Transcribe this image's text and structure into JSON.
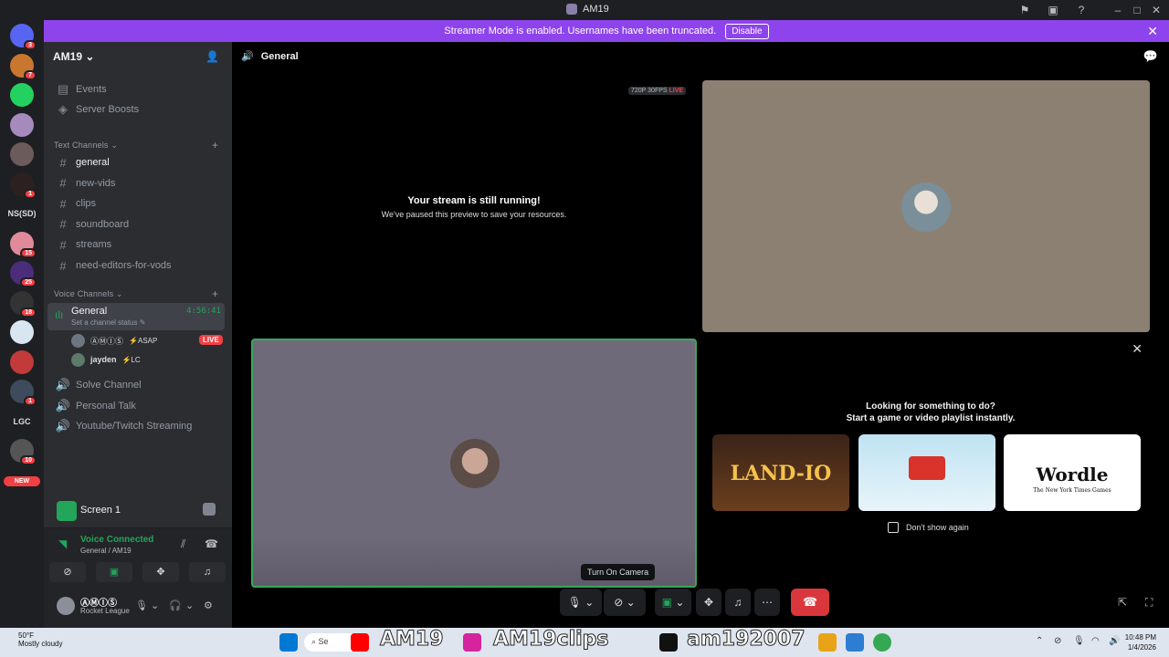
{
  "window": {
    "title": "AM19"
  },
  "banner": {
    "text": "Streamer Mode is enabled. Usernames have been truncated.",
    "button": "Disable"
  },
  "servers": [
    {
      "label": "",
      "badge": "3",
      "color": "#5865f2"
    },
    {
      "label": "",
      "badge": "7",
      "color": "#c9772f"
    },
    {
      "label": "",
      "badge": "",
      "color": "#23d160"
    },
    {
      "label": "",
      "badge": "",
      "color": "#a58bbd"
    },
    {
      "label": "",
      "badge": "",
      "color": "#6b5b5b"
    },
    {
      "label": "",
      "badge": "1",
      "color": "#2c2020"
    },
    {
      "label": "NS(SD)",
      "badge": "",
      "color": ""
    },
    {
      "label": "",
      "badge": "15",
      "color": "#e08a9a"
    },
    {
      "label": "",
      "badge": "25",
      "color": "#4b2d7a"
    },
    {
      "label": "",
      "badge": "18",
      "color": "#333"
    },
    {
      "label": "",
      "badge": "",
      "color": "#d8e6f2"
    },
    {
      "label": "",
      "badge": "",
      "color": "#c23a3a"
    },
    {
      "label": "",
      "badge": "1",
      "color": "#3d4b5c"
    },
    {
      "label": "LGC",
      "badge": "",
      "color": ""
    },
    {
      "label": "",
      "badge": "10",
      "color": "#555"
    },
    {
      "label": "NEW",
      "badge": "",
      "color": "#f23f43"
    }
  ],
  "sidebar": {
    "server_name": "AM19",
    "top_items": [
      {
        "label": "Events",
        "icon": "calendar-icon"
      },
      {
        "label": "Server Boosts",
        "icon": "boost-icon"
      }
    ],
    "text_category": "Text Channels",
    "text_channels": [
      "general",
      "new-vids",
      "clips",
      "soundboard",
      "streams",
      "need-editors-for-vods"
    ],
    "voice_category": "Voice Channels",
    "voice_active": {
      "name": "General",
      "status": "Set a channel status",
      "timer": "4:56:41"
    },
    "voice_users": [
      {
        "name": "ⒶⓂⒾⓈ",
        "tag": "ASAP",
        "live": "LIVE"
      },
      {
        "name": "jayden",
        "tag": "LC",
        "live": ""
      }
    ],
    "voice_channels": [
      "Solve Channel",
      "Personal Talk",
      "Youtube/Twitch Streaming"
    ]
  },
  "screen_panel": {
    "label": "Screen 1"
  },
  "voice_connected": {
    "title": "Voice Connected",
    "subtitle": "General / AM19"
  },
  "user": {
    "name": "ⒶⓂⒾⓈ",
    "status": "Rocket League"
  },
  "main": {
    "channel": "General",
    "stream_quality": "720P 30FPS",
    "live": "LIVE",
    "stream_title": "Your stream is still running!",
    "stream_subtitle": "We've paused this preview to save your resources."
  },
  "activity": {
    "heading1": "Looking for something to do?",
    "heading2": "Start a game or video playlist instantly.",
    "cards": [
      "LAND-IO",
      "",
      "Wordle"
    ],
    "wordle_sub": "The New York Times Games",
    "checkbox_label": "Don't show again"
  },
  "tooltip": "Turn On Camera",
  "taskbar": {
    "weather_temp": "50°F",
    "weather_desc": "Mostly cloudy",
    "search": "Se",
    "time": "10:48 PM",
    "date": "1/4/2026",
    "overlay1": "AM19",
    "overlay2": "AM19clips",
    "overlay3": "am192007"
  }
}
